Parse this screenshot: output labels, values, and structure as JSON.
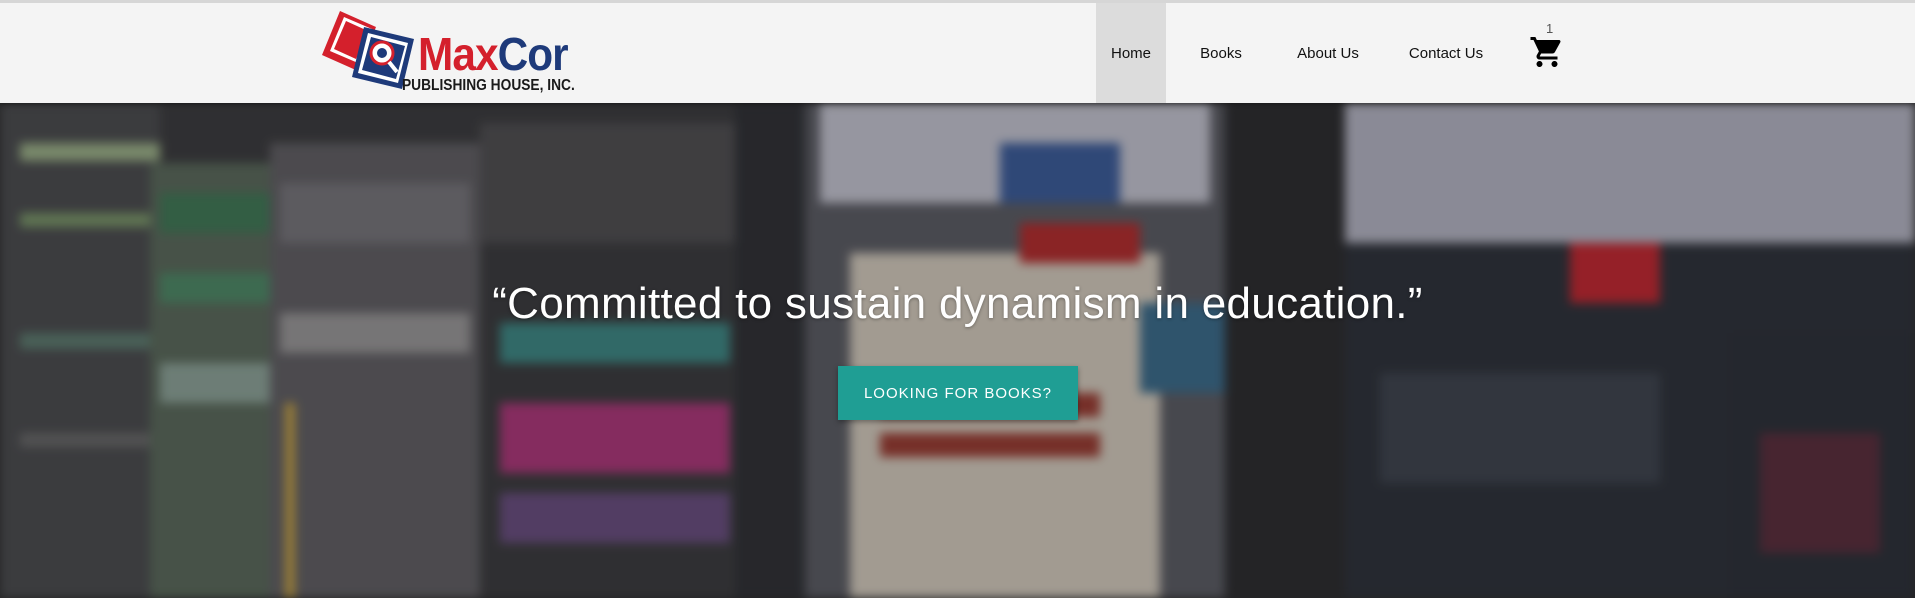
{
  "brand": {
    "name_part1": "Max",
    "name_part2": "Cor",
    "tagline": "PUBLISHING HOUSE, INC.",
    "colors": {
      "red": "#d4202c",
      "blue": "#1e3a7a"
    }
  },
  "nav": {
    "items": [
      {
        "label": "Home",
        "active": true
      },
      {
        "label": "Books",
        "active": false
      },
      {
        "label": "About Us",
        "active": false
      },
      {
        "label": "Contact Us",
        "active": false
      }
    ]
  },
  "cart": {
    "icon": "shopping-cart-icon",
    "count": "1"
  },
  "hero": {
    "quote": "“Committed to sustain dynamism in education.”",
    "button_label": "LOOKING FOR BOOKS?",
    "button_color": "#1f9e94",
    "background": "blurred bookshelf photo"
  }
}
